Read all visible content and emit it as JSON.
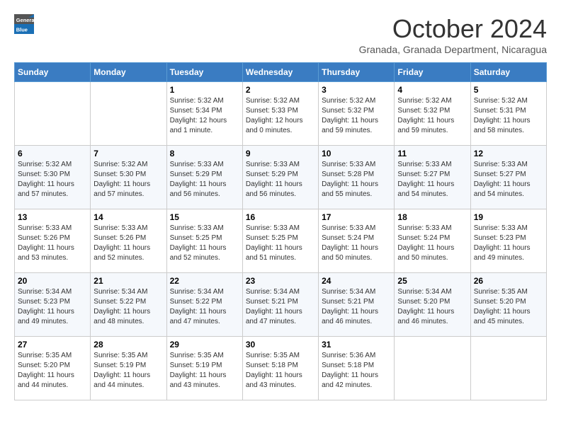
{
  "logo": {
    "general": "General",
    "blue": "Blue"
  },
  "header": {
    "month": "October 2024",
    "location": "Granada, Granada Department, Nicaragua"
  },
  "weekdays": [
    "Sunday",
    "Monday",
    "Tuesday",
    "Wednesday",
    "Thursday",
    "Friday",
    "Saturday"
  ],
  "weeks": [
    [
      {
        "day": "",
        "info": ""
      },
      {
        "day": "",
        "info": ""
      },
      {
        "day": "1",
        "info": "Sunrise: 5:32 AM\nSunset: 5:34 PM\nDaylight: 12 hours\nand 1 minute."
      },
      {
        "day": "2",
        "info": "Sunrise: 5:32 AM\nSunset: 5:33 PM\nDaylight: 12 hours\nand 0 minutes."
      },
      {
        "day": "3",
        "info": "Sunrise: 5:32 AM\nSunset: 5:32 PM\nDaylight: 11 hours\nand 59 minutes."
      },
      {
        "day": "4",
        "info": "Sunrise: 5:32 AM\nSunset: 5:32 PM\nDaylight: 11 hours\nand 59 minutes."
      },
      {
        "day": "5",
        "info": "Sunrise: 5:32 AM\nSunset: 5:31 PM\nDaylight: 11 hours\nand 58 minutes."
      }
    ],
    [
      {
        "day": "6",
        "info": "Sunrise: 5:32 AM\nSunset: 5:30 PM\nDaylight: 11 hours\nand 57 minutes."
      },
      {
        "day": "7",
        "info": "Sunrise: 5:32 AM\nSunset: 5:30 PM\nDaylight: 11 hours\nand 57 minutes."
      },
      {
        "day": "8",
        "info": "Sunrise: 5:33 AM\nSunset: 5:29 PM\nDaylight: 11 hours\nand 56 minutes."
      },
      {
        "day": "9",
        "info": "Sunrise: 5:33 AM\nSunset: 5:29 PM\nDaylight: 11 hours\nand 56 minutes."
      },
      {
        "day": "10",
        "info": "Sunrise: 5:33 AM\nSunset: 5:28 PM\nDaylight: 11 hours\nand 55 minutes."
      },
      {
        "day": "11",
        "info": "Sunrise: 5:33 AM\nSunset: 5:27 PM\nDaylight: 11 hours\nand 54 minutes."
      },
      {
        "day": "12",
        "info": "Sunrise: 5:33 AM\nSunset: 5:27 PM\nDaylight: 11 hours\nand 54 minutes."
      }
    ],
    [
      {
        "day": "13",
        "info": "Sunrise: 5:33 AM\nSunset: 5:26 PM\nDaylight: 11 hours\nand 53 minutes."
      },
      {
        "day": "14",
        "info": "Sunrise: 5:33 AM\nSunset: 5:26 PM\nDaylight: 11 hours\nand 52 minutes."
      },
      {
        "day": "15",
        "info": "Sunrise: 5:33 AM\nSunset: 5:25 PM\nDaylight: 11 hours\nand 52 minutes."
      },
      {
        "day": "16",
        "info": "Sunrise: 5:33 AM\nSunset: 5:25 PM\nDaylight: 11 hours\nand 51 minutes."
      },
      {
        "day": "17",
        "info": "Sunrise: 5:33 AM\nSunset: 5:24 PM\nDaylight: 11 hours\nand 50 minutes."
      },
      {
        "day": "18",
        "info": "Sunrise: 5:33 AM\nSunset: 5:24 PM\nDaylight: 11 hours\nand 50 minutes."
      },
      {
        "day": "19",
        "info": "Sunrise: 5:33 AM\nSunset: 5:23 PM\nDaylight: 11 hours\nand 49 minutes."
      }
    ],
    [
      {
        "day": "20",
        "info": "Sunrise: 5:34 AM\nSunset: 5:23 PM\nDaylight: 11 hours\nand 49 minutes."
      },
      {
        "day": "21",
        "info": "Sunrise: 5:34 AM\nSunset: 5:22 PM\nDaylight: 11 hours\nand 48 minutes."
      },
      {
        "day": "22",
        "info": "Sunrise: 5:34 AM\nSunset: 5:22 PM\nDaylight: 11 hours\nand 47 minutes."
      },
      {
        "day": "23",
        "info": "Sunrise: 5:34 AM\nSunset: 5:21 PM\nDaylight: 11 hours\nand 47 minutes."
      },
      {
        "day": "24",
        "info": "Sunrise: 5:34 AM\nSunset: 5:21 PM\nDaylight: 11 hours\nand 46 minutes."
      },
      {
        "day": "25",
        "info": "Sunrise: 5:34 AM\nSunset: 5:20 PM\nDaylight: 11 hours\nand 46 minutes."
      },
      {
        "day": "26",
        "info": "Sunrise: 5:35 AM\nSunset: 5:20 PM\nDaylight: 11 hours\nand 45 minutes."
      }
    ],
    [
      {
        "day": "27",
        "info": "Sunrise: 5:35 AM\nSunset: 5:20 PM\nDaylight: 11 hours\nand 44 minutes."
      },
      {
        "day": "28",
        "info": "Sunrise: 5:35 AM\nSunset: 5:19 PM\nDaylight: 11 hours\nand 44 minutes."
      },
      {
        "day": "29",
        "info": "Sunrise: 5:35 AM\nSunset: 5:19 PM\nDaylight: 11 hours\nand 43 minutes."
      },
      {
        "day": "30",
        "info": "Sunrise: 5:35 AM\nSunset: 5:18 PM\nDaylight: 11 hours\nand 43 minutes."
      },
      {
        "day": "31",
        "info": "Sunrise: 5:36 AM\nSunset: 5:18 PM\nDaylight: 11 hours\nand 42 minutes."
      },
      {
        "day": "",
        "info": ""
      },
      {
        "day": "",
        "info": ""
      }
    ]
  ]
}
